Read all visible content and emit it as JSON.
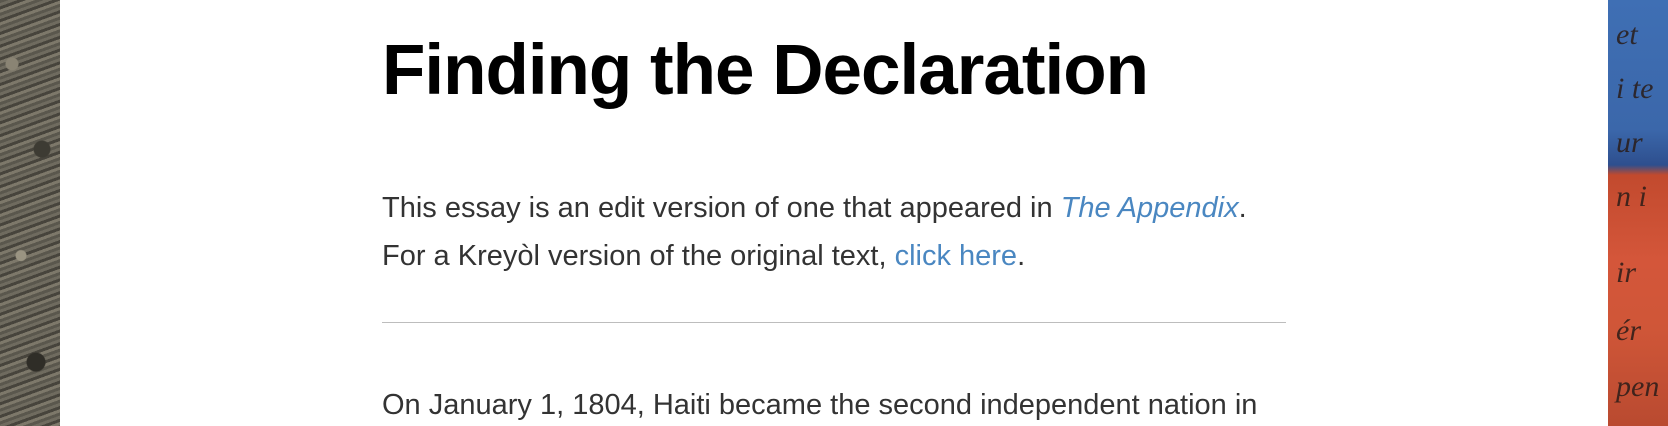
{
  "article": {
    "title": "Finding the Declaration",
    "intro": {
      "line1_prefix": "This essay is an edit version of one that appeared in ",
      "line1_link": "The Appendix",
      "line1_suffix": ".",
      "line2_prefix": "For a Kreyòl version of the original text, ",
      "line2_link": "click here",
      "line2_suffix": "."
    },
    "body_first_line": "On January 1, 1804, Haiti became the second independent nation in"
  },
  "decor": {
    "right_image_fragments": [
      "et",
      "i te",
      "ur",
      "n i",
      "ir",
      "ér",
      "pen"
    ]
  },
  "colors": {
    "link": "#4a87c1",
    "text": "#333333",
    "title": "#000000",
    "divider": "#bdbdbd"
  }
}
